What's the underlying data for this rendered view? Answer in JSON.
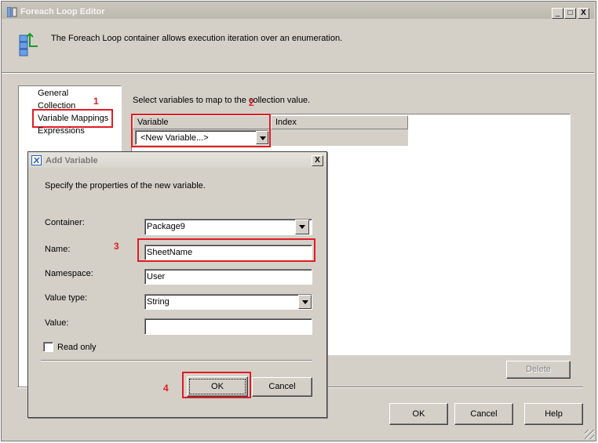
{
  "window": {
    "title": "Foreach Loop Editor",
    "description": "The Foreach Loop container allows execution iteration over an enumeration.",
    "minimize": "_",
    "maximize": "□",
    "close": "X"
  },
  "nav": {
    "items": [
      "General",
      "Collection",
      "Variable Mappings",
      "Expressions"
    ],
    "selected": "Variable Mappings"
  },
  "mappings": {
    "instruction": "Select variables to map to the collection value.",
    "col_variable": "Variable",
    "col_index": "Index",
    "new_variable": "<New Variable...>",
    "delete": "Delete"
  },
  "footer": {
    "ok": "OK",
    "cancel": "Cancel",
    "help": "Help"
  },
  "dialog": {
    "title": "Add Variable",
    "close": "X",
    "instruction": "Specify the properties of the new variable.",
    "container_label": "Container:",
    "container_value": "Package9",
    "name_label": "Name:",
    "name_value": "SheetName",
    "namespace_label": "Namespace:",
    "namespace_value": "User",
    "value_type_label": "Value type:",
    "value_type_value": "String",
    "value_label": "Value:",
    "value_value": "",
    "read_only_label": "Read only",
    "read_only_checked": false,
    "ok": "OK",
    "cancel": "Cancel"
  },
  "annotations": {
    "a1": "1",
    "a2": "2",
    "a3": "3",
    "a4": "4"
  },
  "colors": {
    "annotation": "#e01c24",
    "face": "#d4d0c8"
  }
}
